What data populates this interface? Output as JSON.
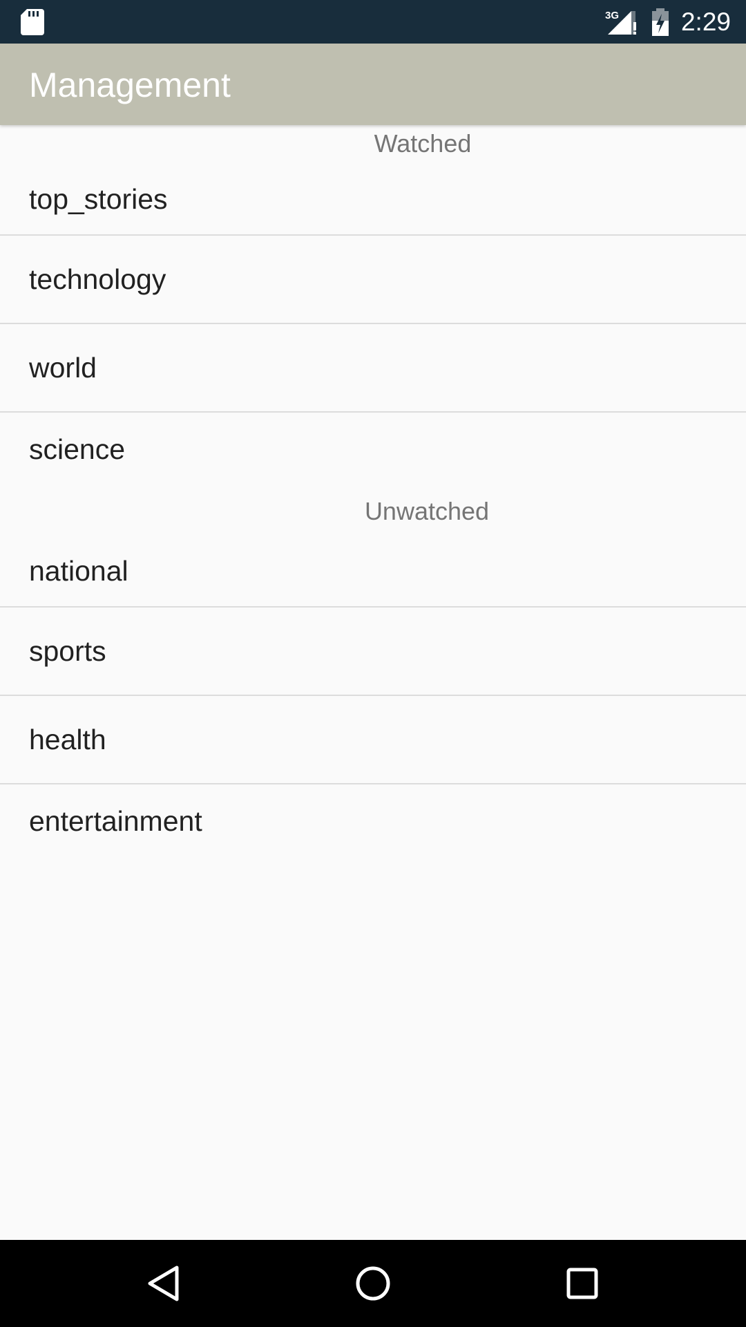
{
  "status_bar": {
    "time": "2:29",
    "network": "3G",
    "icons": [
      "sd-card-icon",
      "signal-icon",
      "battery-icon"
    ]
  },
  "app_bar": {
    "title": "Management",
    "background": "#bfbfb0"
  },
  "sections": [
    {
      "header": "Watched",
      "items": [
        "top_stories",
        "technology",
        "world",
        "science"
      ]
    },
    {
      "header": "Unwatched",
      "items": [
        "national",
        "sports",
        "health",
        "entertainment"
      ]
    }
  ],
  "nav_bar": {
    "icons": [
      "back-icon",
      "home-icon",
      "recents-icon"
    ]
  },
  "colors": {
    "status_bar": "#182d3c",
    "background": "#fafafa",
    "divider": "#dcdcdc",
    "text_primary": "#212121",
    "text_secondary": "#757575"
  }
}
